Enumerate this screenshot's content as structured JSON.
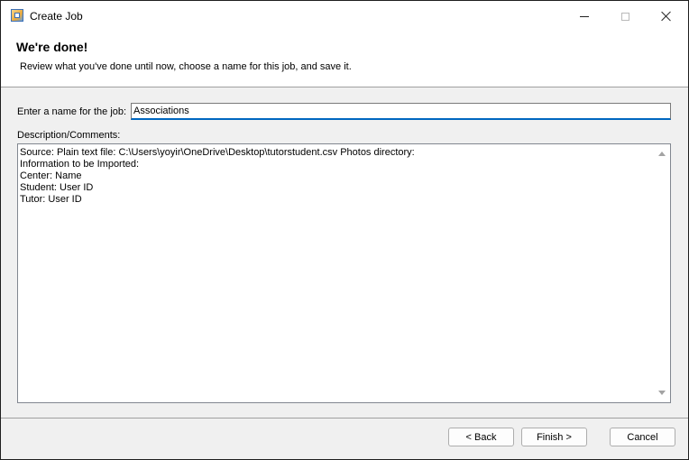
{
  "window": {
    "title": "Create Job",
    "icon": "app-wizard-icon"
  },
  "caption_buttons": {
    "minimize_icon": "minimize-icon",
    "maximize_icon": "maximize-icon",
    "close_icon": "close-icon"
  },
  "header": {
    "title": "We're done!",
    "subtitle": "Review what you've done until now, choose a name for this job, and save it."
  },
  "form": {
    "name_label": "Enter a name for the job:",
    "name_value": "Associations",
    "description_label": "Description/Comments:",
    "description_lines": [
      "Source: Plain text file: C:\\Users\\yoyir\\OneDrive\\Desktop\\tutorstudent.csv Photos directory:",
      "Information to be Imported:",
      "Center: Name",
      "Student: User ID",
      "Tutor: User ID"
    ]
  },
  "buttons": {
    "back": "< Back",
    "finish": "Finish >",
    "cancel": "Cancel"
  },
  "colors": {
    "accent": "#0067c0",
    "dialog_background": "#f0f0f0"
  }
}
